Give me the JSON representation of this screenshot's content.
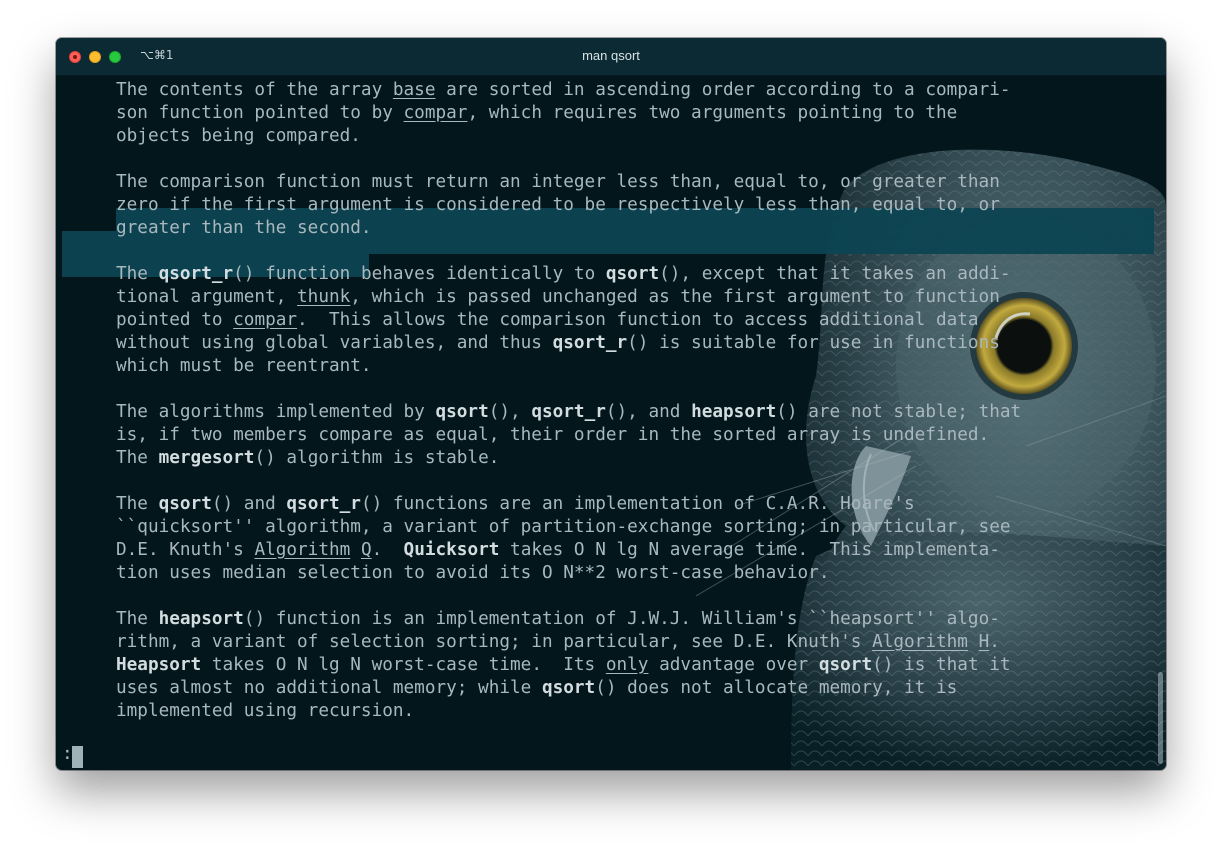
{
  "window": {
    "shortcut": "⌥⌘1",
    "title": "man qsort"
  },
  "colors": {
    "background": "#03161c",
    "titlebar": "#0c2a33",
    "text": "#a9b8be",
    "bold_text": "#d3dde0",
    "selection": "#0d4552",
    "close": "#ff5f57",
    "minimize": "#febc2e",
    "zoom": "#28c840"
  },
  "icons": [
    "close-icon",
    "minimize-icon",
    "zoom-icon",
    "owl-wallpaper"
  ],
  "man": {
    "p1": {
      "a": "The contents of the array ",
      "base": "base",
      "b": " are sorted in ascending order according to a compari-\nson function pointed to by ",
      "compar": "compar",
      "c": ", which requires two arguments pointing to the\nobjects being compared."
    },
    "p2": {
      "text": "The comparison function must return an integer less than, equal to, or greater than\nzero if the first argument is considered to be respectively less than, equal to, or\ngreater than the second."
    },
    "p3": {
      "a": "The ",
      "qsort_r": "qsort_r",
      "b": "() function behaves identically to ",
      "qsort": "qsort",
      "c": "(), except that it takes an addi-\ntional argument, ",
      "thunk": "thunk",
      "d": ", which is passed unchanged as the first argument to function\npointed to ",
      "compar": "compar",
      "e": ".  This allows the comparison function to access additional data\nwithout using global variables, and thus ",
      "qsort_r2": "qsort_r",
      "f": "() is suitable for use in functions\nwhich must be reentrant."
    },
    "p4": {
      "a": "The algorithms implemented by ",
      "qsort": "qsort",
      "b": "(), ",
      "qsort_r": "qsort_r",
      "c": "(), and ",
      "heapsort": "heapsort",
      "d": "() are not stable; that\nis, if two members compare as equal, their order in the sorted array is undefined.\nThe ",
      "mergesort": "mergesort",
      "e": "() algorithm is stable."
    },
    "p5": {
      "a": "The ",
      "qsort": "qsort",
      "b": "() and ",
      "qsort_r": "qsort_r",
      "c": "() functions are an implementation of C.A.R. Hoare's\n``quicksort'' algorithm, a variant of partition-exchange sorting; in particular, see\nD.E. Knuth's ",
      "algorithm": "Algorithm",
      "d": " ",
      "q": "Q",
      "e": ".  ",
      "quicksort": "Quicksort",
      "f": " takes O N lg N average time.  This implementa-\ntion uses median selection to avoid its O N**2 worst-case behavior."
    },
    "p6": {
      "a": "The ",
      "heapsort": "heapsort",
      "b": "() function is an implementation of J.W.J. William's ``heapsort'' algo-\nrithm, a variant of selection sorting; in particular, see D.E. Knuth's ",
      "algorithm": "Algorithm",
      "c": " ",
      "h": "H",
      "d": ".\n",
      "heapsort2": "Heapsort",
      "e": " takes O N lg N worst-case time.  Its ",
      "only": "only",
      "f": " advantage over ",
      "qsort": "qsort",
      "g": "() is that it\nuses almost no additional memory; while ",
      "qsort2": "qsort",
      "i": "() does not allocate memory, it is\nimplemented using recursion."
    },
    "prompt": ":"
  }
}
